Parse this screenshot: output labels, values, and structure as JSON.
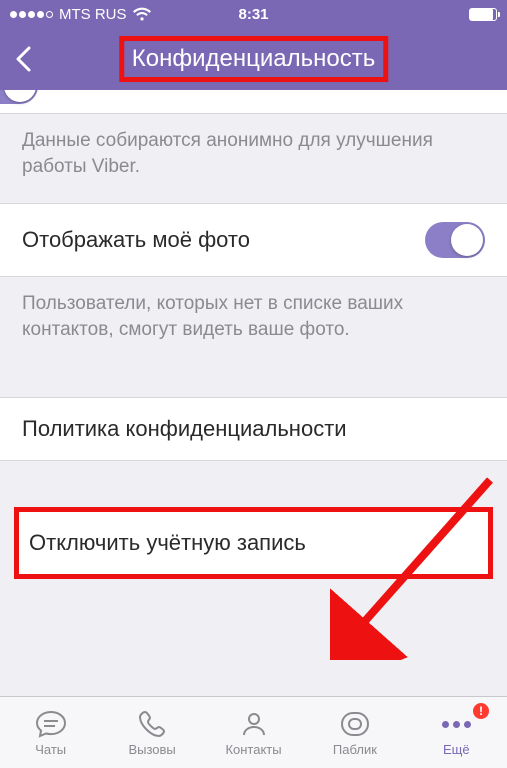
{
  "status": {
    "carrier": "MTS RUS",
    "time": "8:31"
  },
  "nav": {
    "title": "Конфиденциальность"
  },
  "sections": {
    "anon_desc": "Данные собираются анонимно для улучшения работы Viber.",
    "show_photo_label": "Отображать моё фото",
    "show_photo_desc": "Пользователи, которых нет в списке ваших контактов, смогут видеть ваше фото.",
    "privacy_policy_label": "Политика конфиденциальности",
    "deactivate_label": "Отключить учётную запись"
  },
  "tabs": {
    "chats": "Чаты",
    "calls": "Вызовы",
    "contacts": "Контакты",
    "public": "Паблик",
    "more": "Ещё",
    "badge": "!"
  }
}
